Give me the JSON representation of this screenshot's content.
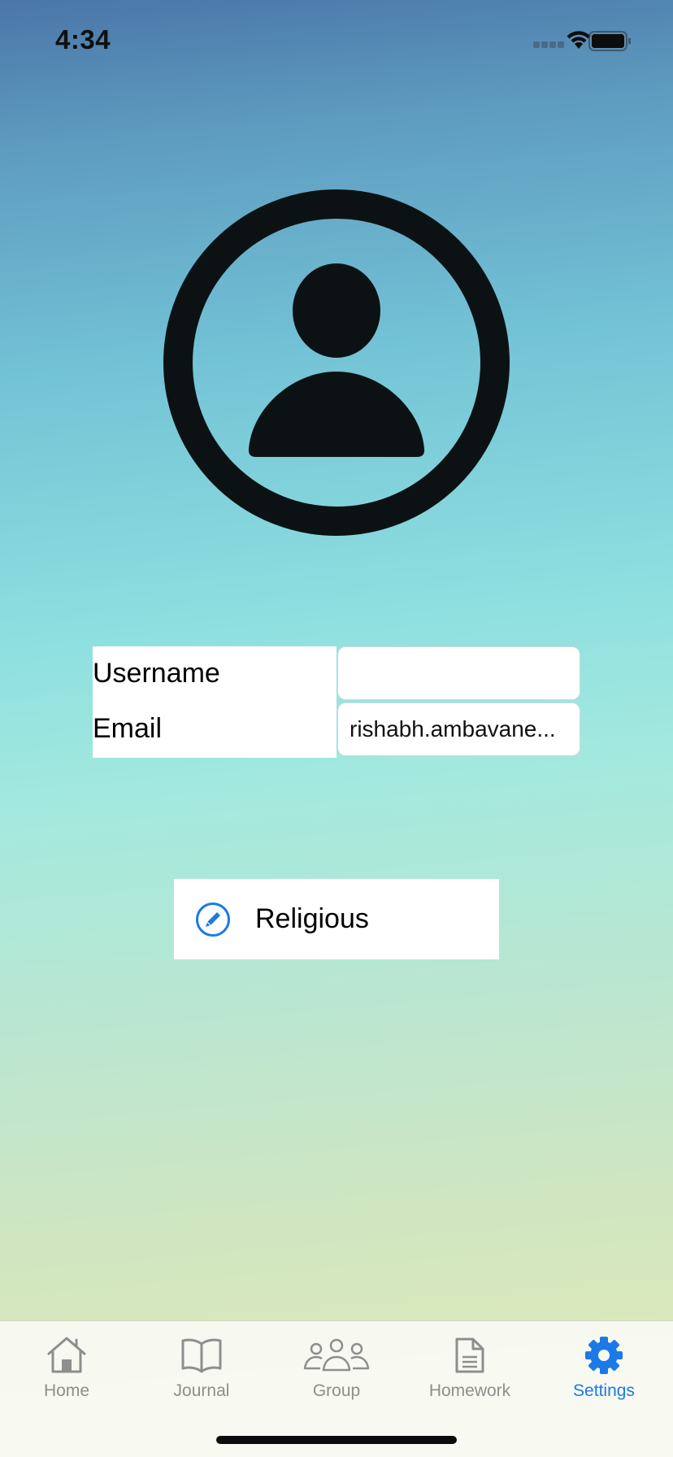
{
  "status_bar": {
    "time": "4:34"
  },
  "profile": {
    "username_label": "Username",
    "username_value": "",
    "email_label": "Email",
    "email_value": "rishabh.ambavane..."
  },
  "religion_button": {
    "label": "Religious"
  },
  "tab_bar": {
    "active_color": "#1b7ae6",
    "inactive_color": "#8e8e8e",
    "tabs": [
      {
        "label": "Home",
        "icon": "house-icon"
      },
      {
        "label": "Journal",
        "icon": "book-icon"
      },
      {
        "label": "Group",
        "icon": "group-icon"
      },
      {
        "label": "Homework",
        "icon": "document-icon"
      },
      {
        "label": "Settings",
        "icon": "gear-icon"
      }
    ]
  }
}
